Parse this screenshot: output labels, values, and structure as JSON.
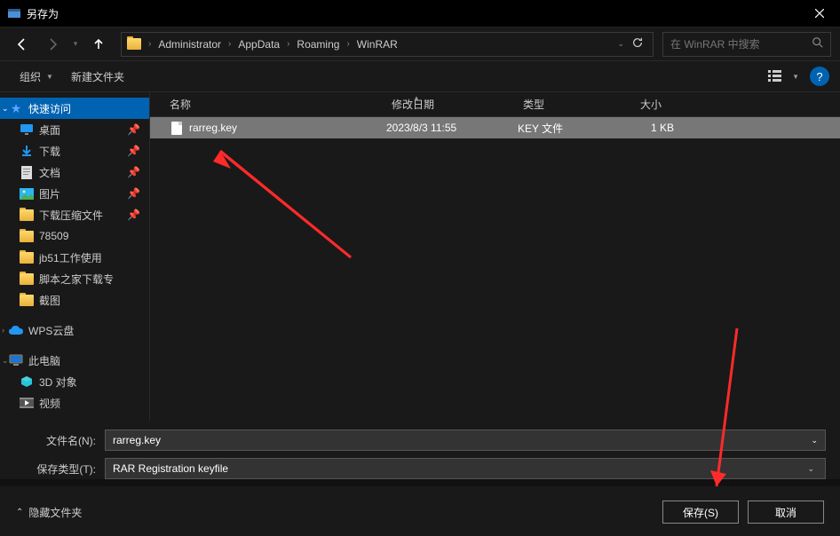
{
  "title": "另存为",
  "breadcrumbs": [
    "Administrator",
    "AppData",
    "Roaming",
    "WinRAR"
  ],
  "search_placeholder": "在 WinRAR 中搜索",
  "toolbar": {
    "organize": "组织",
    "newfolder": "新建文件夹"
  },
  "columns": {
    "name": "名称",
    "date": "修改日期",
    "type": "类型",
    "size": "大小"
  },
  "sidebar": {
    "quick": "快速访问",
    "desktop": "桌面",
    "downloads": "下载",
    "documents": "文档",
    "pictures": "图片",
    "folder1": "下载压缩文件",
    "folder2": "78509",
    "folder3": "jb51工作使用",
    "folder4": "脚本之家下载专",
    "folder5": "截图",
    "wps": "WPS云盘",
    "thispc": "此电脑",
    "objects3d": "3D 对象",
    "videos": "视频"
  },
  "file": {
    "name": "rarreg.key",
    "date": "2023/8/3 11:55",
    "type": "KEY 文件",
    "size": "1 KB"
  },
  "form": {
    "filename_label": "文件名(N):",
    "filename_value": "rarreg.key",
    "type_label": "保存类型(T):",
    "type_value": "RAR Registration keyfile"
  },
  "footer": {
    "hide": "隐藏文件夹",
    "save": "保存(S)",
    "cancel": "取消"
  }
}
